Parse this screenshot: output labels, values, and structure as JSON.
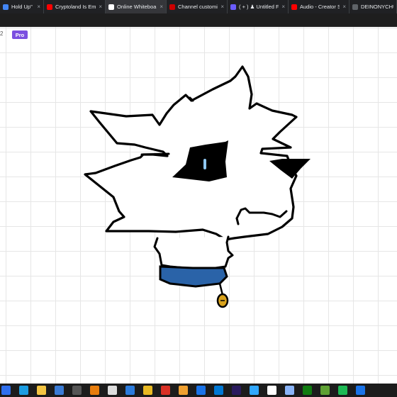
{
  "browser": {
    "tabs": [
      {
        "title": "Hold Up\" Memes",
        "favicon": "generic-icon",
        "favicon_color": "#4285f4",
        "active": false
      },
      {
        "title": "Cryptoland Is Emb",
        "favicon": "youtube-icon",
        "favicon_color": "#ff0000",
        "active": false
      },
      {
        "title": "Online Whiteboard",
        "favicon": "whiteboard-icon",
        "favicon_color": "#ffffff",
        "active": true
      },
      {
        "title": "Channel customiz",
        "favicon": "youtube-studio-icon",
        "favicon_color": "#cc0000",
        "active": false
      },
      {
        "title": "( + ) ♟ Untitled Fr",
        "favicon": "app-icon",
        "favicon_color": "#6a5cff",
        "active": false
      },
      {
        "title": "Audio - Creator St",
        "favicon": "youtube-icon",
        "favicon_color": "#ff0000",
        "active": false
      },
      {
        "title": "DEINONYCHUS -",
        "favicon": "generic-icon",
        "favicon_color": "#5f6368",
        "active": false
      }
    ]
  },
  "app": {
    "board_code": "2",
    "pro_badge": "Pro"
  },
  "drawing": {
    "subject": "wolf-head-sketch",
    "outline_color": "#000000",
    "collar_color": "#2a63a8",
    "tag_color": "#d9a21b",
    "eye_highlight_color": "#8fc7f0"
  },
  "taskbar": {
    "icons": [
      {
        "name": "start-icon",
        "color": "#2f6fed"
      },
      {
        "name": "edge-icon",
        "color": "#1b9de2"
      },
      {
        "name": "explorer-icon",
        "color": "#f4c542"
      },
      {
        "name": "store-icon",
        "color": "#3a7bd5"
      },
      {
        "name": "obs-icon",
        "color": "#555555"
      },
      {
        "name": "blender-icon",
        "color": "#e87d0d"
      },
      {
        "name": "3d-viewer-icon",
        "color": "#dddddd"
      },
      {
        "name": "people-icon",
        "color": "#2b7bdc"
      },
      {
        "name": "chrome-icon",
        "color": "#e8b923"
      },
      {
        "name": "app-red-icon",
        "color": "#d93025"
      },
      {
        "name": "paint-icon",
        "color": "#f0a030"
      },
      {
        "name": "settings-icon",
        "color": "#1a73e8"
      },
      {
        "name": "mail-icon",
        "color": "#0078d4"
      },
      {
        "name": "premiere-icon",
        "color": "#2a1a5e"
      },
      {
        "name": "photoshop-icon",
        "color": "#31a8ff"
      },
      {
        "name": "capcut-icon",
        "color": "#ffffff"
      },
      {
        "name": "dots-icon",
        "color": "#8ab4f8"
      },
      {
        "name": "xbox-icon",
        "color": "#107c10"
      },
      {
        "name": "minecraft-icon",
        "color": "#5fa134"
      },
      {
        "name": "spotify-icon",
        "color": "#1db954"
      },
      {
        "name": "app-blue-icon",
        "color": "#1a73e8"
      }
    ]
  }
}
